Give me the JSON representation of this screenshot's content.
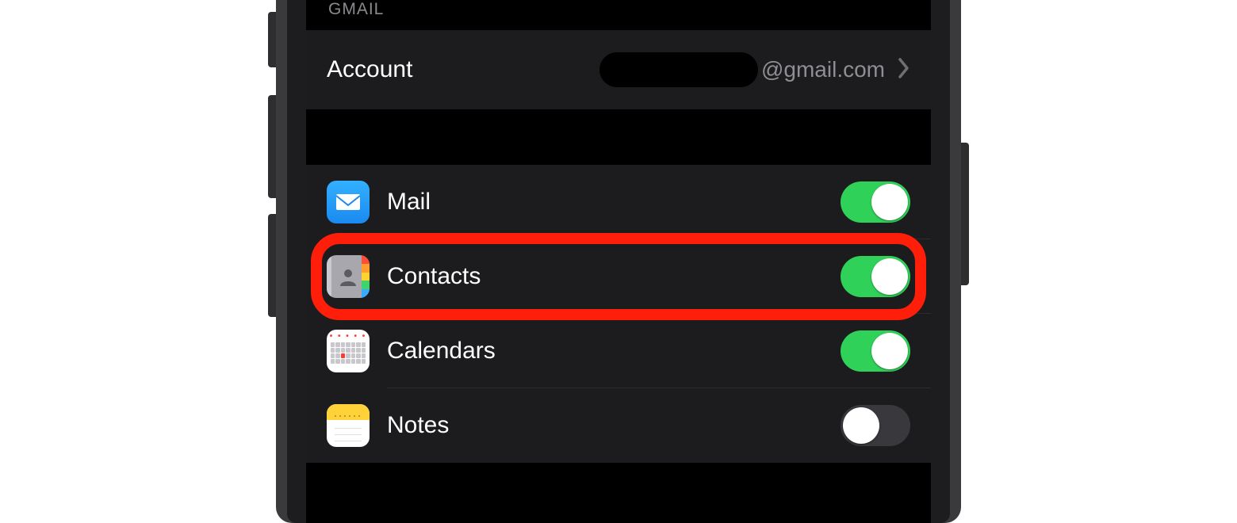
{
  "section_header": "GMAIL",
  "account": {
    "label": "Account",
    "value_suffix": "@gmail.com"
  },
  "toggles": [
    {
      "key": "mail",
      "label": "Mail",
      "icon": "mail-icon",
      "on": true
    },
    {
      "key": "contacts",
      "label": "Contacts",
      "icon": "contacts-icon",
      "on": true
    },
    {
      "key": "calendars",
      "label": "Calendars",
      "icon": "calendar-icon",
      "on": true
    },
    {
      "key": "notes",
      "label": "Notes",
      "icon": "notes-icon",
      "on": false
    }
  ],
  "highlighted_row": "contacts",
  "colors": {
    "toggle_on": "#30d158",
    "toggle_off": "#39393d",
    "highlight_ring": "#ff1e0a",
    "cell_bg": "#1c1c1e",
    "text_primary": "#ffffff",
    "text_secondary": "#8e8e93"
  }
}
